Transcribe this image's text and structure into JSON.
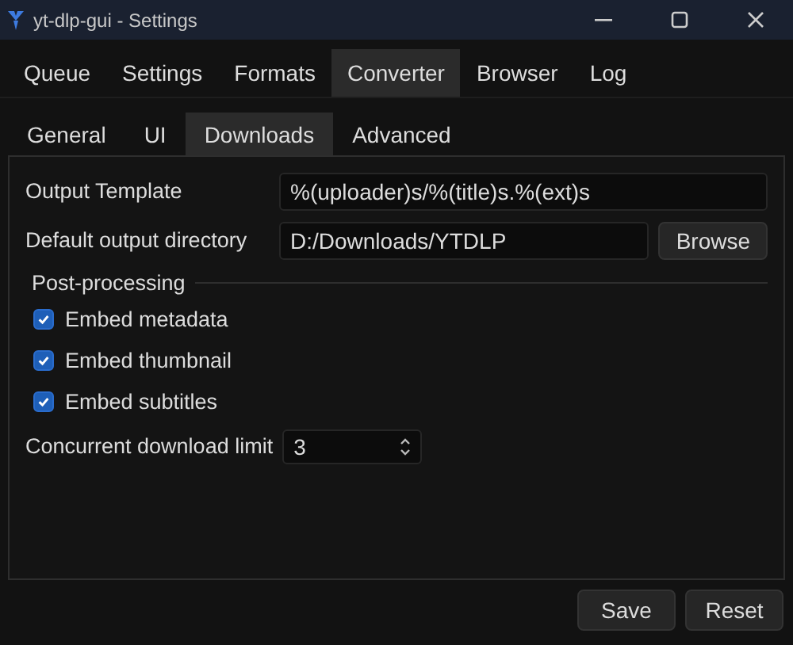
{
  "window": {
    "title": "yt-dlp-gui - Settings"
  },
  "tabs": [
    {
      "label": "Queue",
      "selected": false
    },
    {
      "label": "Settings",
      "selected": false
    },
    {
      "label": "Formats",
      "selected": false
    },
    {
      "label": "Converter",
      "selected": true
    },
    {
      "label": "Browser",
      "selected": false
    },
    {
      "label": "Log",
      "selected": false
    }
  ],
  "subtabs": [
    {
      "label": "General",
      "selected": false
    },
    {
      "label": "UI",
      "selected": false
    },
    {
      "label": "Downloads",
      "selected": true
    },
    {
      "label": "Advanced",
      "selected": false
    }
  ],
  "fields": [
    {
      "label": "Output Template",
      "value": "%(uploader)s/%(title)s.%(ext)s"
    },
    {
      "label": "Default output directory",
      "value": "D:/Downloads/YTDLP",
      "button": "Browse"
    }
  ],
  "group": {
    "title": "Post-processing"
  },
  "checkboxes": [
    {
      "label": "Embed metadata",
      "checked": true
    },
    {
      "label": "Embed thumbnail",
      "checked": true
    },
    {
      "label": "Embed subtitles",
      "checked": true
    }
  ],
  "spin": {
    "label": "Concurrent download limit",
    "value": "3"
  },
  "buttons": [
    "Save",
    "Reset"
  ]
}
